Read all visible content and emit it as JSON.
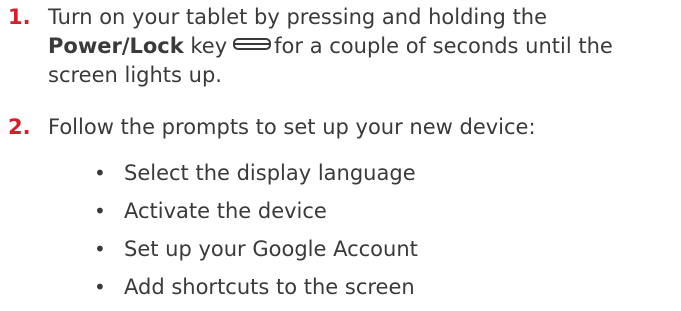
{
  "steps": [
    {
      "number": "1.",
      "line1": "Turn on your tablet by pressing and holding the",
      "line2_strong": "Power/Lock",
      "line2_after_strong": " key",
      "line2_after_icon": "for a couple of seconds until the",
      "line3": "screen lights up.",
      "icon": "power-lock-key-icon"
    },
    {
      "number": "2.",
      "line1": "Follow the prompts to set up your new device:",
      "bullets": [
        "Select the display language",
        "Activate the device",
        "Set up your Google Account",
        "Add shortcuts to the screen"
      ],
      "bullet_char": "•"
    }
  ],
  "colors": {
    "step_number": "#d41e2c",
    "body_text": "#3a3a3a"
  }
}
